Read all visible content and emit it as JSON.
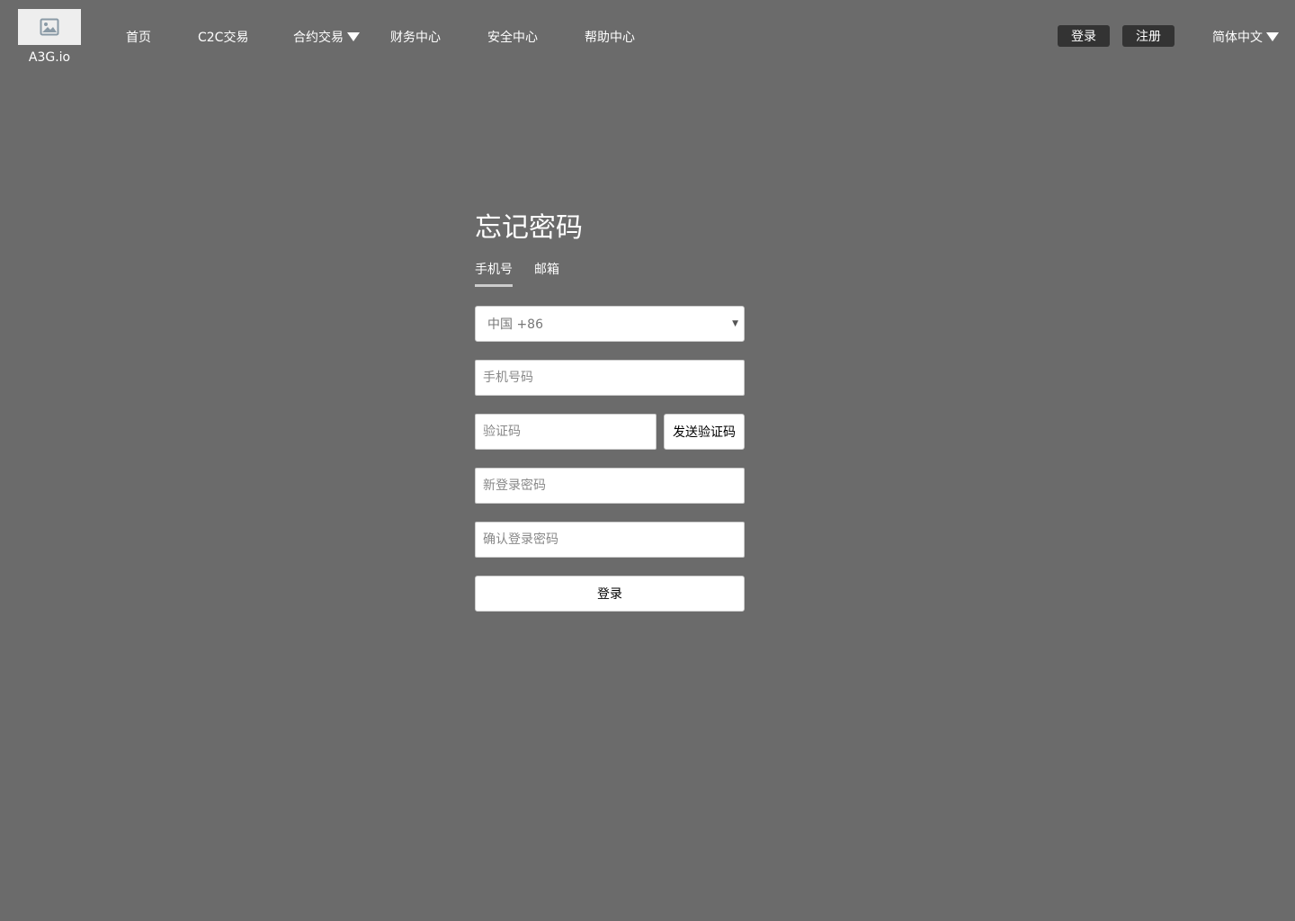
{
  "header": {
    "logo_text": "A3G.io",
    "logo_icon": "image-placeholder-icon",
    "nav": [
      {
        "label": "首页"
      },
      {
        "label": "C2C交易"
      },
      {
        "label": "合约交易",
        "dropdown": true
      },
      {
        "label": "财务中心"
      },
      {
        "label": "安全中心"
      },
      {
        "label": "帮助中心"
      }
    ],
    "login_label": "登录",
    "register_label": "注册",
    "language": "简体中文"
  },
  "form": {
    "title": "忘记密码",
    "tabs": [
      {
        "label": "手机号",
        "active": true
      },
      {
        "label": "邮箱",
        "active": false
      }
    ],
    "country_select": "中国 +86",
    "phone_placeholder": "手机号码",
    "code_placeholder": "验证码",
    "send_code_label": "发送验证码",
    "new_password_placeholder": "新登录密码",
    "confirm_password_placeholder": "确认登录密码",
    "submit_label": "登录"
  },
  "colors": {
    "background": "#6b6b6b",
    "dark_button": "#333333",
    "field_background": "#ffffff"
  }
}
